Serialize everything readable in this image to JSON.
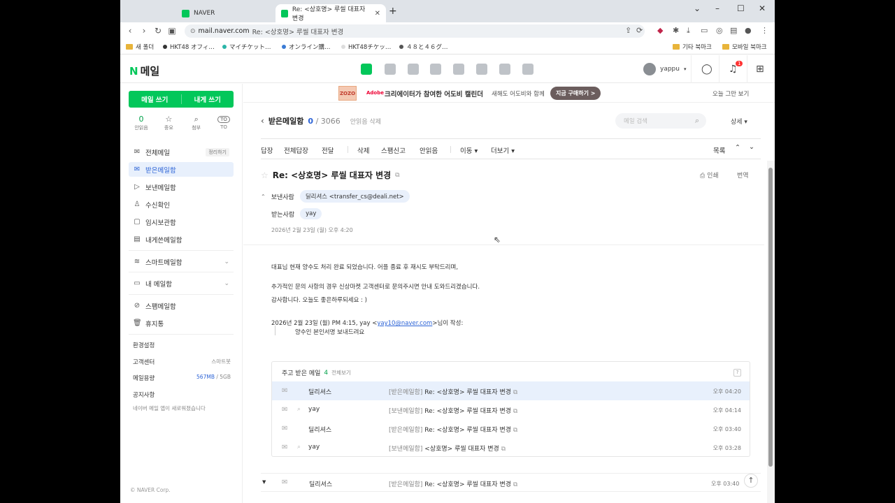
{
  "browser": {
    "tabs": [
      {
        "label": "NAVER",
        "color": "#03c75a"
      },
      {
        "label": "Re: <상호명> 루씰 대표자 변경",
        "color": "#03c75a"
      }
    ],
    "url_host": "mail.naver.com",
    "url_path": "Re: <상호명> 루씰 대표자 변경",
    "bookmarks": [
      {
        "label": "새 폴더",
        "icon": "folder-icon"
      },
      {
        "label": "HKT48 オフィ…",
        "icon": "dot"
      },
      {
        "label": "マイチケット…",
        "icon": "dot"
      },
      {
        "label": "オンライン購…",
        "icon": "dot"
      },
      {
        "label": "HKT48チケッ…",
        "icon": "dot"
      },
      {
        "label": "４８と４６グ…",
        "icon": "dot"
      }
    ],
    "bookmark_folders_right": [
      "기타 북마크",
      "모바일 북마크"
    ]
  },
  "naver": {
    "logo_n": "N",
    "logo_text": "메일",
    "user_name": "yappu",
    "notification_count": "1"
  },
  "sidebar": {
    "write_mail": "메일 쓰기",
    "write_self": "내게 쓰기",
    "quick": [
      {
        "value": "0",
        "label": "안읽음"
      },
      {
        "value": "☆",
        "label": "중요"
      },
      {
        "value": "⌕",
        "label": "첨부"
      },
      {
        "value": "TO",
        "label": "TO"
      }
    ],
    "items": [
      {
        "label": "전체메일",
        "extra": "정리하기"
      },
      {
        "label": "받은메일함"
      },
      {
        "label": "보낸메일함"
      },
      {
        "label": "수신확인"
      },
      {
        "label": "임시보관함"
      },
      {
        "label": "내게쓴메일함"
      },
      {
        "label": "스마트메일함"
      },
      {
        "label": "내 메일함"
      },
      {
        "label": "스팸메일함"
      },
      {
        "label": "휴지통"
      }
    ],
    "settings": "환경설정",
    "support": "고객센터",
    "support_badge": "스마트봇",
    "storage_label": "메일용량",
    "storage_used": "567MB",
    "storage_total": " / 5GB",
    "notice": "공지사항",
    "notice_text": "네이버 메일 앱이 새로워졌습니다",
    "copyright": "© NAVER Corp."
  },
  "ad": {
    "thumb": "ZOZO",
    "brand": "Adobe",
    "headline": "크리에이터가 참여한 어도비 캘린더",
    "subtext": "새해도 어도비와 함께",
    "cta": "지금 구매하기 >",
    "close": "오늘 그만 보기"
  },
  "mailbox": {
    "title": "받은메일함",
    "unread": "0",
    "total": "/ 3066",
    "delete_unread": "안읽음 삭제",
    "search_placeholder": "메일 검색",
    "detail": "상세 ▾"
  },
  "toolbar": {
    "reply": "답장",
    "reply_all": "전체답장",
    "forward": "전달",
    "delete": "삭제",
    "spam": "스팸신고",
    "unread": "안읽음",
    "move": "이동 ▾",
    "more": "더보기 ▾",
    "list": "목록"
  },
  "mail": {
    "subject": "Re: <상호명> 루씰 대표자 변경",
    "print": "인쇄",
    "translate": "번역",
    "from_label": "보낸사람",
    "from": "딜리셔스 <transfer_cs@deali.net>",
    "to_label": "받는사람",
    "to": "yay",
    "date": "2026년 2월 23일 (월) 오후 4:20",
    "body": [
      "대표님 현재 양수도 처리 완료 되었습니다. 어플 종료 후 재시도 부탁드리며,",
      "추가적인 문의 사항의 경우 신상마켓 고객센터로 문의주시면 안내 도와드리겠습니다.",
      "감사합니다. 오늘도 좋은하루되세요 : )"
    ],
    "quote_head": "2026년 2월 23일 (월) PM 4:15, yay <",
    "quote_email": "yay10@naver.com",
    "quote_tail": ">님이 작성:",
    "quote_text": "양수인 본인서명 보내드려요"
  },
  "related": {
    "title": "주고 받은 메일",
    "count": "4",
    "view_all": "전체보기",
    "rows": [
      {
        "from": "딜리셔스",
        "box": "[받은메일함]",
        "subject": " Re: <상호명> 루씰 대표자 변경",
        "time": "오후 04:20",
        "clip": ""
      },
      {
        "from": "yay",
        "box": "[보낸메일함]",
        "subject": " Re: <상호명> 루씰 대표자 변경",
        "time": "오후 04:14",
        "clip": "⌕"
      },
      {
        "from": "딜리셔스",
        "box": "[받은메일함]",
        "subject": " Re: <상호명> 루씰 대표자 변경",
        "time": "오후 03:40",
        "clip": ""
      },
      {
        "from": "yay",
        "box": "[보낸메일함]",
        "subject": " <상호명> 루씰 대표자 변경",
        "time": "오후 03:28",
        "clip": "⌕"
      }
    ]
  },
  "last_row": {
    "from": "딜리셔스",
    "box": "[받은메일함]",
    "subject": " Re: <상호명> 루씰 대표자 변경",
    "time": "오후 03:40"
  }
}
